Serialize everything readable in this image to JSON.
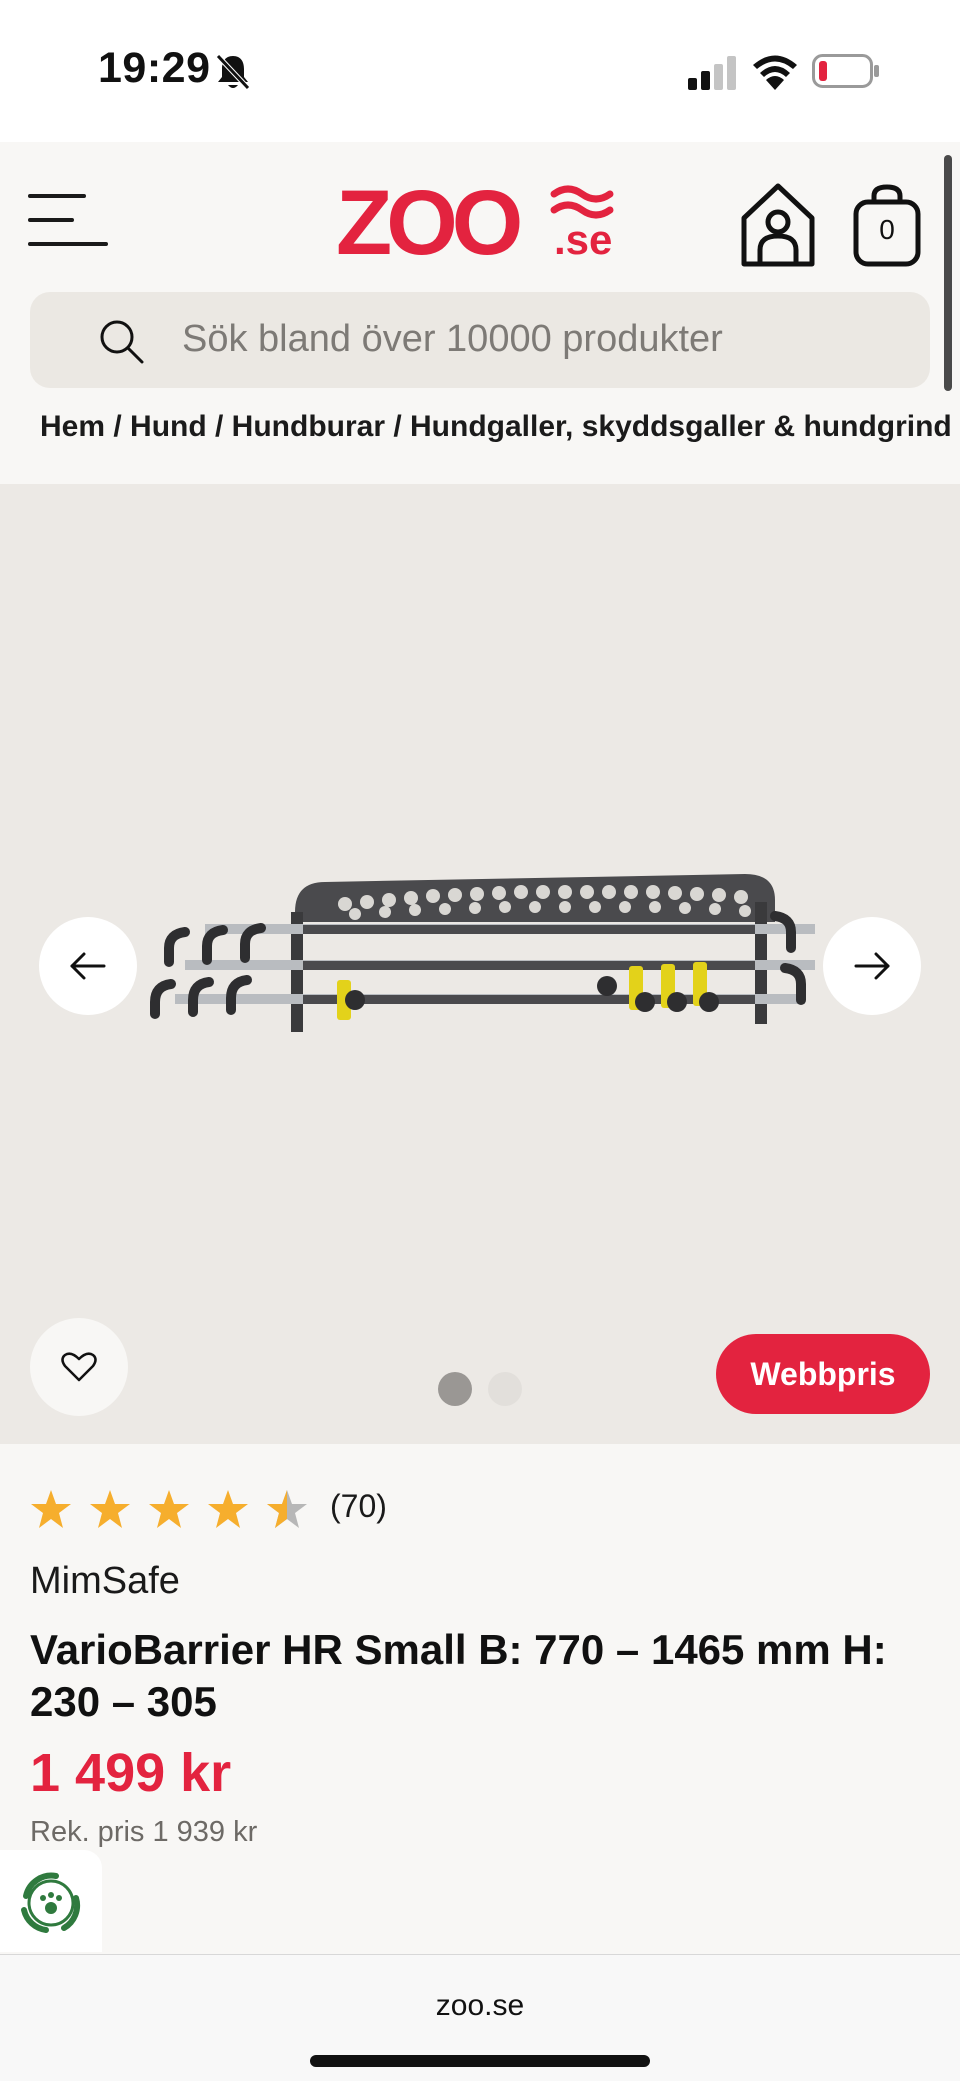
{
  "status": {
    "time": "19:29",
    "icons": [
      "bell-off-icon",
      "cellular-signal-icon",
      "wifi-icon",
      "battery-low-icon"
    ]
  },
  "header": {
    "logo": {
      "main": "ZOO",
      "suffix": ".se",
      "color": "#e3233f"
    },
    "cart_count": "0",
    "search_placeholder": "Sök bland över 10000 produkter"
  },
  "breadcrumb": {
    "text": "Hem / Hund / Hundburar / Hundgaller, skyddsgaller & hundgrind"
  },
  "gallery": {
    "current_image": 1,
    "image_count": 2,
    "badge_label": "Webbpris"
  },
  "product": {
    "rating": 4.5,
    "rating_max": 5,
    "review_count": "(70)",
    "brand": "MimSafe",
    "title": "VarioBarrier HR Small B: 770 – 1465 mm H: 230 – 305",
    "price": "1 499 kr",
    "rek_price": "Rek. pris 1 939 kr"
  },
  "browser": {
    "url": "zoo.se"
  },
  "colors": {
    "accent": "#e3233f",
    "star": "#f6ae2d",
    "background": "#f8f7f5",
    "gallery_bg": "#ece9e5"
  }
}
